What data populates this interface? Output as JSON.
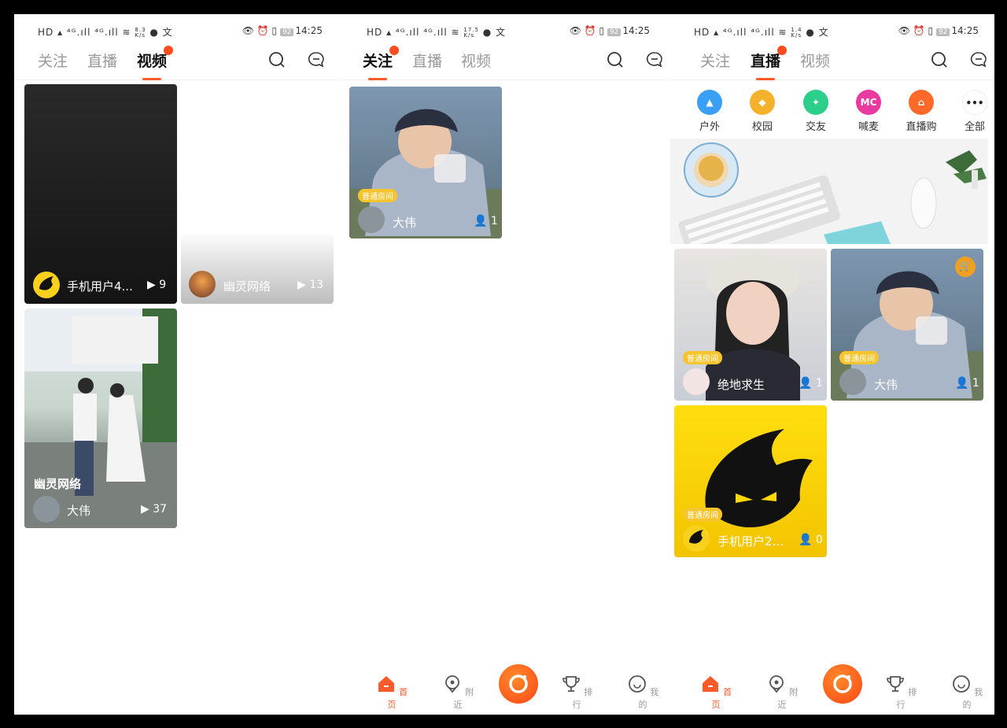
{
  "status_bar": {
    "network_left": "HD",
    "speeds": [
      "8.3",
      "17.5",
      "1.4"
    ],
    "speed_unit": "K/s",
    "battery": "92",
    "time": "14:25"
  },
  "tabs": {
    "follow": "关注",
    "live": "直播",
    "video": "视频"
  },
  "screen1": {
    "videos": [
      {
        "name": "手机用户4...",
        "count": "9"
      },
      {
        "name": "幽灵网络",
        "count": "13"
      },
      {
        "name": "大伟",
        "count": "37",
        "caption": "幽灵网络"
      }
    ]
  },
  "screen2": {
    "rooms": [
      {
        "tag": "普通房间",
        "name": "大伟",
        "count": "1"
      }
    ]
  },
  "screen3": {
    "categories": [
      {
        "label": "户外",
        "icon": "mountain-icon",
        "color": "#3aa0f5"
      },
      {
        "label": "校园",
        "icon": "graduation-cap-icon",
        "color": "#f4b22a"
      },
      {
        "label": "交友",
        "icon": "dancer-icon",
        "color": "#2ccf8a"
      },
      {
        "label": "喊麦",
        "icon": "mc-icon",
        "color": "#e83aa0",
        "text": "MC"
      },
      {
        "label": "直播购",
        "icon": "shopping-bag-icon",
        "color": "#ff6a2a"
      },
      {
        "label": "全部",
        "icon": "more-dots-icon",
        "color": "#ffffff"
      }
    ],
    "rooms": [
      {
        "tag": "普通房间",
        "name": "绝地求生",
        "count": "1"
      },
      {
        "tag": "普通房间",
        "name": "大伟",
        "count": "1"
      },
      {
        "tag": "普通房间",
        "name": "手机用户2...",
        "count": "0"
      }
    ]
  },
  "bottom_nav": {
    "home": "首页",
    "nearby": "附近",
    "rank": "排行",
    "mine": "我的"
  },
  "colors": {
    "accent": "#ff5a2a",
    "tag": "#f6c42c"
  }
}
